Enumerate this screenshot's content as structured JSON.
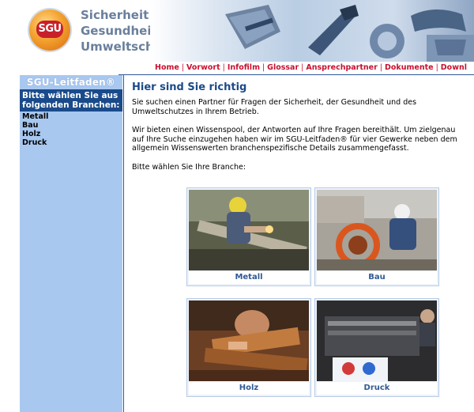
{
  "header": {
    "logo_text": "SGU",
    "brand_lines": [
      "Sicherheit",
      "Gesundheit",
      "Umweltschutz"
    ]
  },
  "nav": {
    "items": [
      "Home",
      "Vorwort",
      "Infofilm",
      "Glossar",
      "Ansprechpartner",
      "Dokumente",
      "Downl"
    ]
  },
  "sidebar": {
    "title": "SGU-Leitfaden®",
    "heading": "Bitte wählen Sie aus folgenden Branchen:",
    "items": [
      "Metall",
      "Bau",
      "Holz",
      "Druck"
    ]
  },
  "main": {
    "title": "Hier sind Sie richtig",
    "para1": "Sie suchen einen Partner für Fragen der Sicherheit, der Gesundheit und des Umweltschutzes in Ihrem Betrieb.",
    "para2": "Wir bieten einen Wissenspool, der Antworten auf Ihre Fragen bereithält. Um zielgenau auf Ihre Suche einzugehen haben wir im SGU-Leitfaden® für vier Gewerke neben dem allgemein Wissenswerten branchenspezifische Details zusammengefasst.",
    "prompt": "Bitte wählen Sie Ihre Branche:",
    "tiles": [
      {
        "label": "Metall"
      },
      {
        "label": "Bau"
      },
      {
        "label": "Holz"
      },
      {
        "label": "Druck"
      }
    ]
  }
}
